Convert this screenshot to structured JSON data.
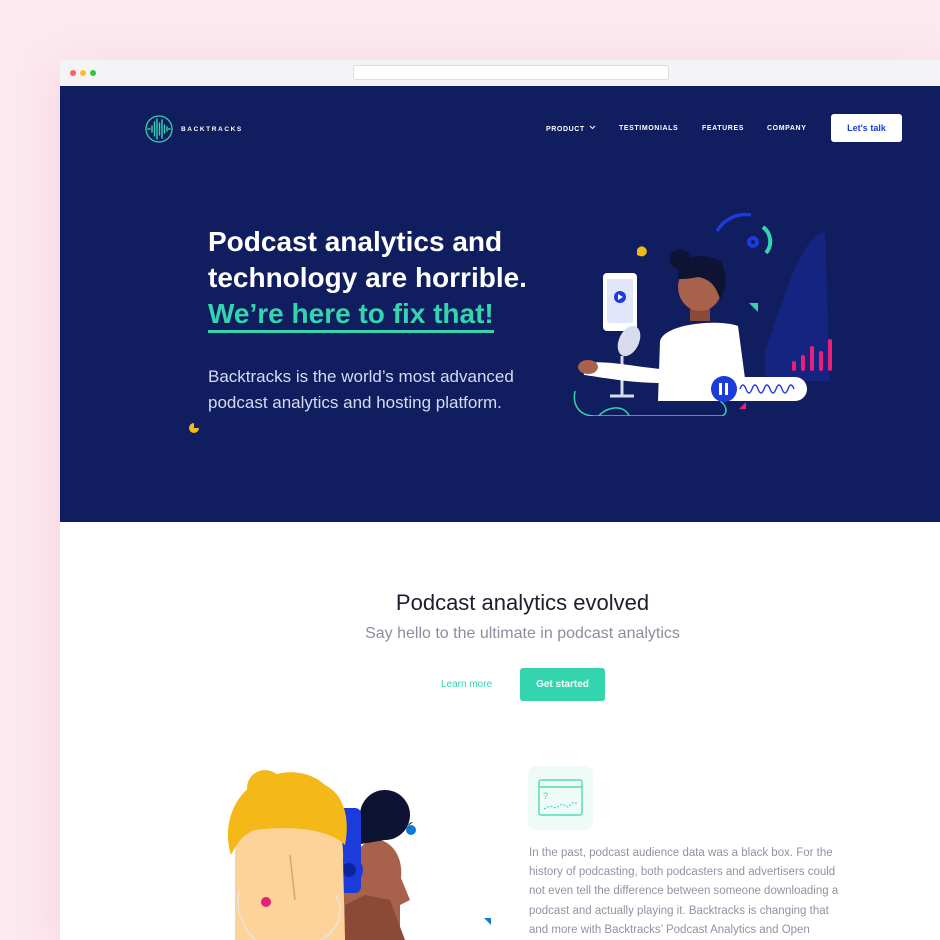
{
  "brand": {
    "name": "BACKTRACKS"
  },
  "nav": {
    "items": [
      "PRODUCT",
      "TESTIMONIALS",
      "FEATURES",
      "COMPANY"
    ],
    "cta": "Let's talk"
  },
  "hero": {
    "headline_line1": "Podcast analytics and",
    "headline_line2": "technology are horrible.",
    "headline_accent": "We’re here to fix that!",
    "subcopy": "Backtracks is the world’s most advanced podcast analytics and hosting platform."
  },
  "section": {
    "title": "Podcast analytics evolved",
    "subtitle": "Say hello to the ultimate in podcast analytics",
    "learn_more": "Learn more",
    "get_started": "Get started"
  },
  "feature": {
    "body": "In the past, podcast audience data was a black box. For the history of podcasting, both podcasters and advertisers could not even tell the difference between someone downloading a podcast and actually playing it. Backtracks is changing that and more with Backtracks’ Podcast Analytics and Open"
  },
  "colors": {
    "hero_bg": "#101d5e",
    "accent": "#34d5ae",
    "cta_text": "#1b3bdb",
    "page_bg": "#fde8ef"
  },
  "icons": [
    "soundwave-logo-icon",
    "chevron-down-icon",
    "play-icon",
    "pause-icon",
    "analytics-window-icon"
  ]
}
